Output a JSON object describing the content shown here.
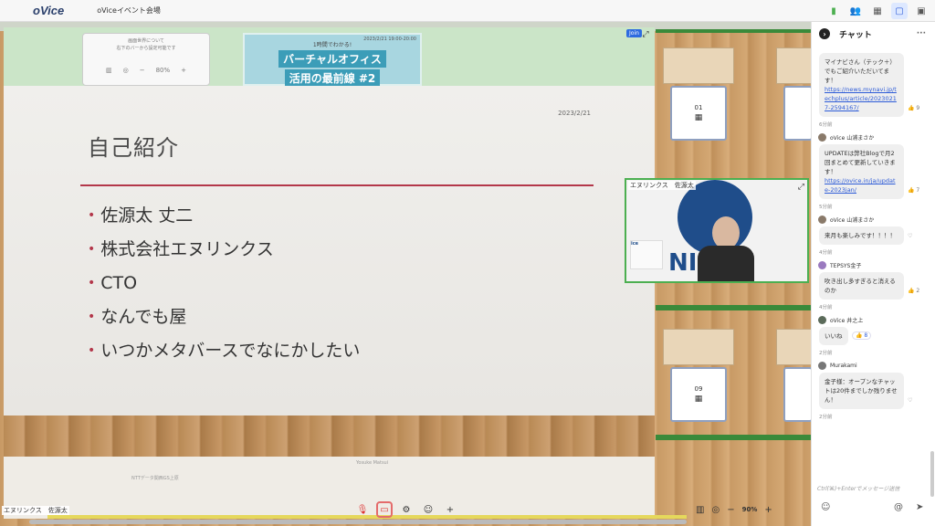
{
  "app": {
    "logo": "oVice",
    "event_name": "oViceイベント会場"
  },
  "top_icons": [
    "signal-icon",
    "people-icon",
    "calendar-icon",
    "chat-icon",
    "profile-icon"
  ],
  "screen": {
    "notice_text": "画面世界について\n右下のバーから設定可能です",
    "notice_zoom": "80%",
    "join_label": "Join",
    "banner": {
      "small": "1時間でわかる!",
      "line1": "バーチャルオフィス",
      "line2": "活用の最前線 #2",
      "date": "2023/2/21 19:00-20:00"
    },
    "slide": {
      "date": "2023/2/21",
      "title": "自己紹介",
      "bullets": [
        "佐源太 丈二",
        "株式会社エヌリンクス",
        "CTO",
        "なんでも屋",
        "いつかメタバースでなにかしたい"
      ]
    },
    "floor_labels": [
      "NTTデータ関西GS上原",
      "Yosuke Matsui"
    ]
  },
  "desks": [
    {
      "label": "01"
    },
    {
      "label": "09"
    }
  ],
  "video": {
    "name": "エヌリンクス　佐源太",
    "logo_text": "NI",
    "thumb_text": "ice"
  },
  "bottom": {
    "name_tag": "エヌリンクス　佐源太",
    "zoom": "90%"
  },
  "chat": {
    "title": "チャット",
    "messages": [
      {
        "sender": "",
        "text": "マイナビさん（テック＋）でもご紹介いただいてます！",
        "link": "https://news.mynavi.jp/techplus/article/20230217-2594167/",
        "reaction": "👍 9",
        "time": "6分前"
      },
      {
        "sender": "oVice 山浦まさか",
        "text": "UPDATEは弊社Blogで月2回まとめて更新していきます！",
        "link": "https://ovice.in/ja/update-2023jan/",
        "reaction": "👍 7",
        "time": "5分前"
      },
      {
        "sender": "oVice 山浦まさか",
        "text": "来月も楽しみです！！！！",
        "link": "",
        "reaction": "♡",
        "time": "4分前"
      },
      {
        "sender": "TEPSYS金子",
        "text": "吹き出し多すぎると消えるのか",
        "link": "",
        "reaction": "👍 2",
        "time": "4分前"
      },
      {
        "sender": "oVice 井之上",
        "text": "いいね",
        "link": "",
        "reaction": "👍 8",
        "time": "2分前"
      },
      {
        "sender": "Murakami",
        "text": "金子様：オープンなチャットは20件までしか残りません！",
        "link": "",
        "reaction": "♡",
        "time": "2分前"
      }
    ],
    "input_placeholder": "Ctrl(⌘)+Enterでメッセージ送信"
  }
}
